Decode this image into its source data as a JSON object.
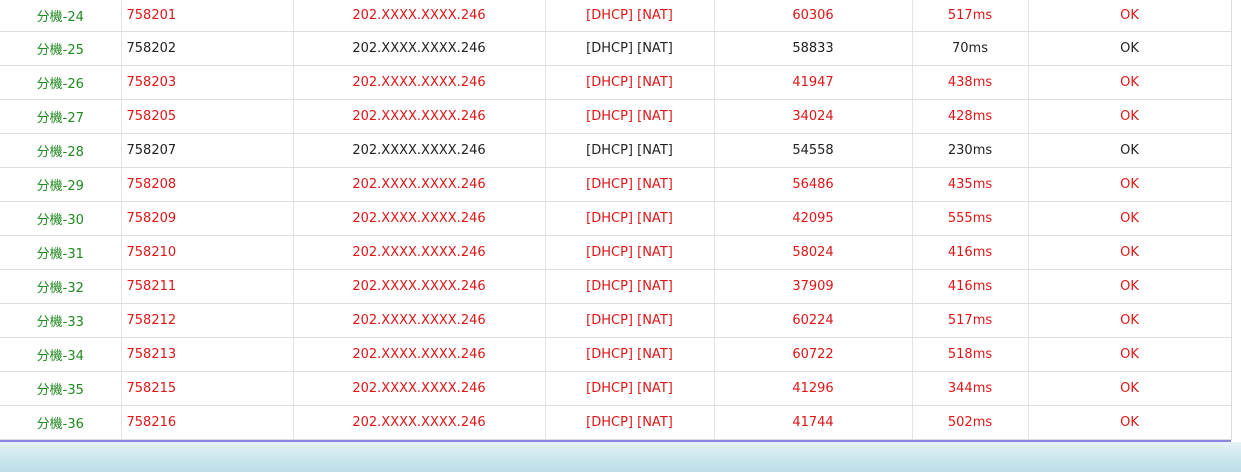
{
  "rows": [
    {
      "name": "分機-24",
      "number": "758201",
      "ip": "202.XXXX.XXXX.246",
      "mode": "[DHCP] [NAT]",
      "port": "60306",
      "latency": "517ms",
      "status": "OK",
      "highlight": true
    },
    {
      "name": "分機-25",
      "number": "758202",
      "ip": "202.XXXX.XXXX.246",
      "mode": "[DHCP] [NAT]",
      "port": "58833",
      "latency": "70ms",
      "status": "OK",
      "highlight": false
    },
    {
      "name": "分機-26",
      "number": "758203",
      "ip": "202.XXXX.XXXX.246",
      "mode": "[DHCP] [NAT]",
      "port": "41947",
      "latency": "438ms",
      "status": "OK",
      "highlight": true
    },
    {
      "name": "分機-27",
      "number": "758205",
      "ip": "202.XXXX.XXXX.246",
      "mode": "[DHCP] [NAT]",
      "port": "34024",
      "latency": "428ms",
      "status": "OK",
      "highlight": true
    },
    {
      "name": "分機-28",
      "number": "758207",
      "ip": "202.XXXX.XXXX.246",
      "mode": "[DHCP] [NAT]",
      "port": "54558",
      "latency": "230ms",
      "status": "OK",
      "highlight": false
    },
    {
      "name": "分機-29",
      "number": "758208",
      "ip": "202.XXXX.XXXX.246",
      "mode": "[DHCP] [NAT]",
      "port": "56486",
      "latency": "435ms",
      "status": "OK",
      "highlight": true
    },
    {
      "name": "分機-30",
      "number": "758209",
      "ip": "202.XXXX.XXXX.246",
      "mode": "[DHCP] [NAT]",
      "port": "42095",
      "latency": "555ms",
      "status": "OK",
      "highlight": true
    },
    {
      "name": "分機-31",
      "number": "758210",
      "ip": "202.XXXX.XXXX.246",
      "mode": "[DHCP] [NAT]",
      "port": "58024",
      "latency": "416ms",
      "status": "OK",
      "highlight": true
    },
    {
      "name": "分機-32",
      "number": "758211",
      "ip": "202.XXXX.XXXX.246",
      "mode": "[DHCP] [NAT]",
      "port": "37909",
      "latency": "416ms",
      "status": "OK",
      "highlight": true
    },
    {
      "name": "分機-33",
      "number": "758212",
      "ip": "202.XXXX.XXXX.246",
      "mode": "[DHCP] [NAT]",
      "port": "60224",
      "latency": "517ms",
      "status": "OK",
      "highlight": true
    },
    {
      "name": "分機-34",
      "number": "758213",
      "ip": "202.XXXX.XXXX.246",
      "mode": "[DHCP] [NAT]",
      "port": "60722",
      "latency": "518ms",
      "status": "OK",
      "highlight": true
    },
    {
      "name": "分機-35",
      "number": "758215",
      "ip": "202.XXXX.XXXX.246",
      "mode": "[DHCP] [NAT]",
      "port": "41296",
      "latency": "344ms",
      "status": "OK",
      "highlight": true
    },
    {
      "name": "分機-36",
      "number": "758216",
      "ip": "202.XXXX.XXXX.246",
      "mode": "[DHCP] [NAT]",
      "port": "41744",
      "latency": "502ms",
      "status": "OK",
      "highlight": true
    }
  ],
  "colors": {
    "name_text": "#1f8a1f",
    "warn_text": "#e01515",
    "ok_text": "#222222",
    "footer_line": "#8c83e3"
  }
}
